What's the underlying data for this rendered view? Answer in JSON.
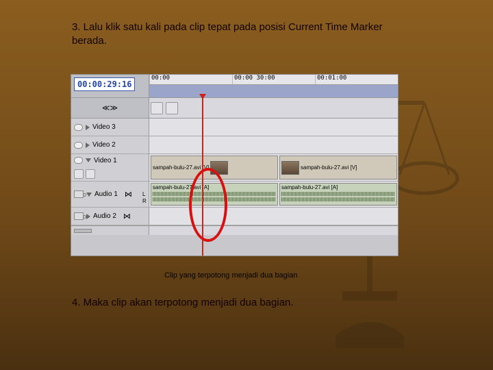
{
  "instruction3": "3. Lalu klik satu kali pada clip tepat pada posisi Current Time Marker berada.",
  "caption": "Clip yang terpotong menjadi dua bagian",
  "instruction4": "4. Maka clip akan terpotong menjadi dua bagian.",
  "timecode": "00:00:29:16",
  "ruler": {
    "t0": "00:00",
    "t1": "00:00 30:00",
    "t2": "00:01:00"
  },
  "toolsLabel": "≪≫",
  "tracks": {
    "video3": "Video 3",
    "video2": "Video 2",
    "video1": "Video 1",
    "audio1": "Audio 1",
    "audio2": "Audio 2"
  },
  "clips": {
    "v1a": "sampah-bulu-27.avi [V]",
    "v1b": "sampah-bulu-27.avi [V]",
    "a1a": "sampah-bulu-27.avi [A]",
    "a1b": "sampah-bulu-27.avi [A]"
  },
  "lr": {
    "l": "L",
    "r": "R"
  }
}
